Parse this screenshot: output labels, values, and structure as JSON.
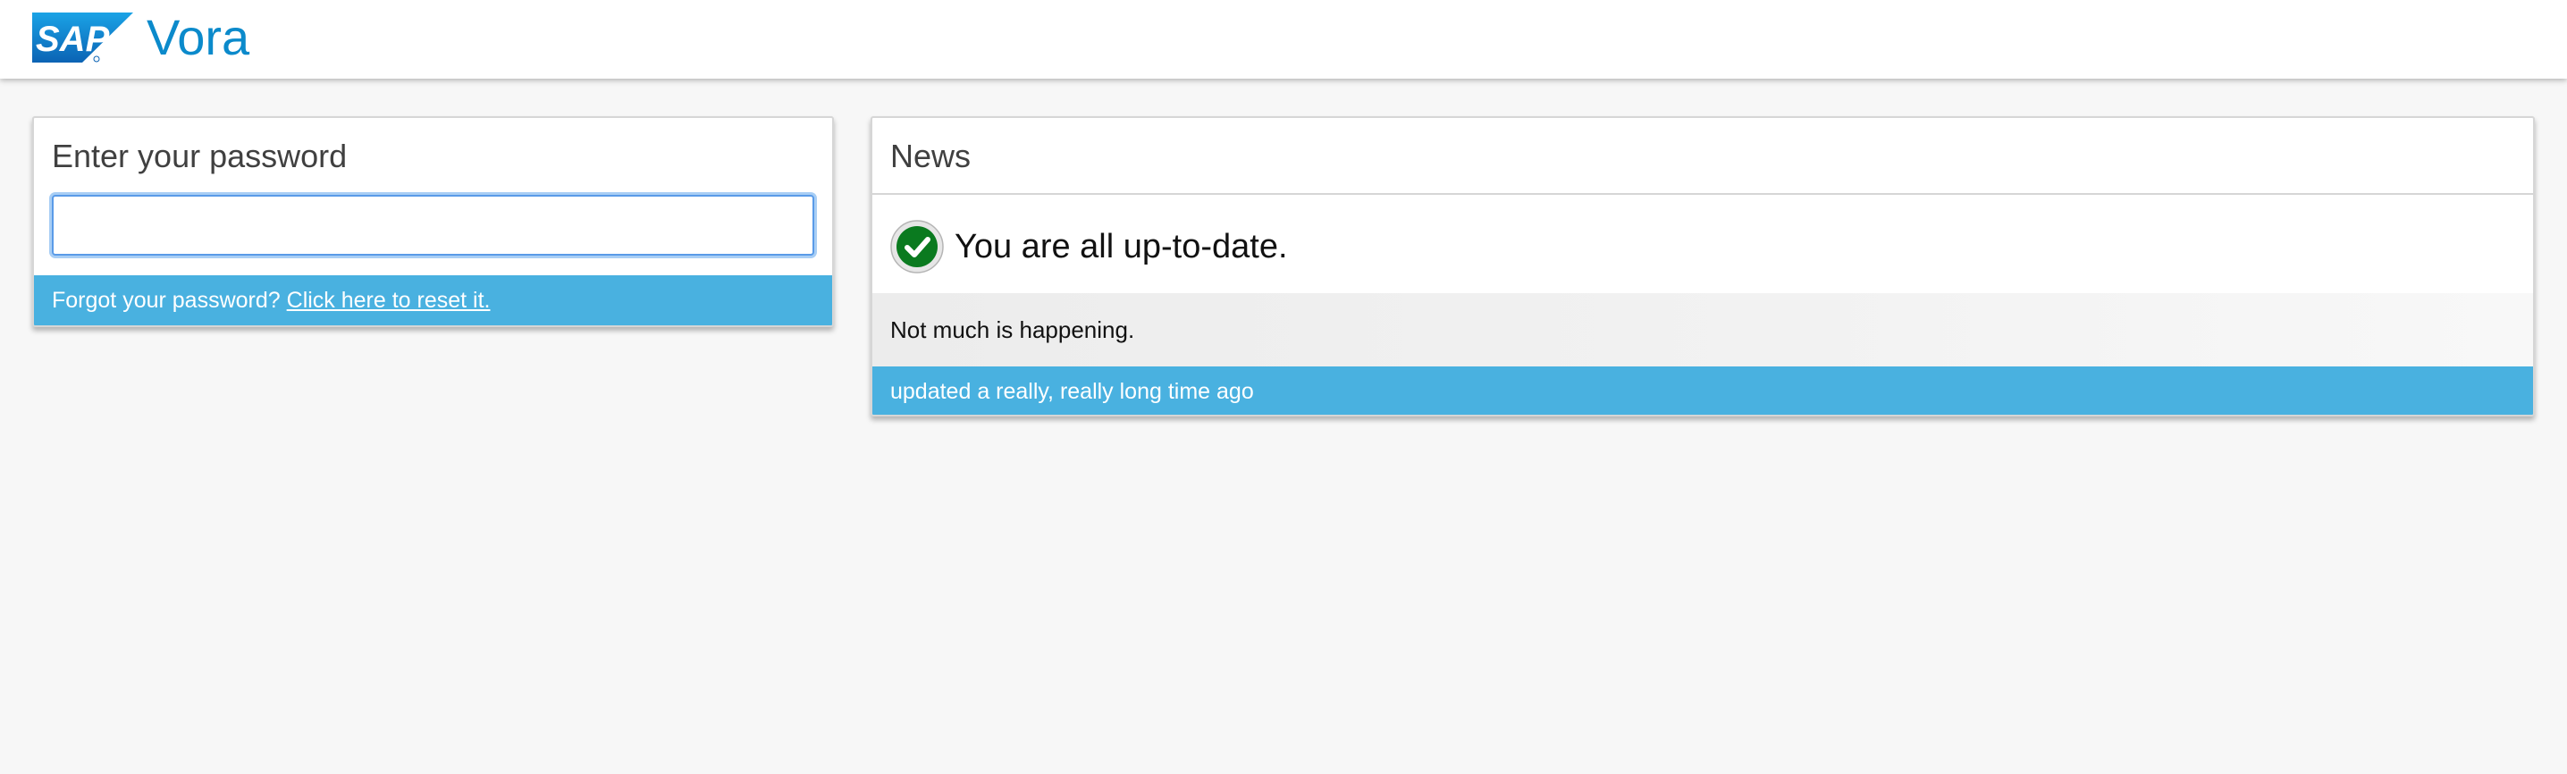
{
  "header": {
    "logo_text": "SAP",
    "app_title": "Vora"
  },
  "password_panel": {
    "title": "Enter your password",
    "input_value": "",
    "forgot_text": "Forgot your password?",
    "reset_link": "Click here to reset it."
  },
  "news_panel": {
    "title": "News",
    "status_icon": "check-circle-icon",
    "status_text": "You are all up-to-date.",
    "message": "Not much is happening.",
    "footer": "updated a really, really long time ago"
  },
  "colors": {
    "brand_blue": "#0b8acb",
    "footer_blue": "#49b1e0",
    "check_green": "#0a7a1f",
    "background": "#f7f7f7"
  }
}
